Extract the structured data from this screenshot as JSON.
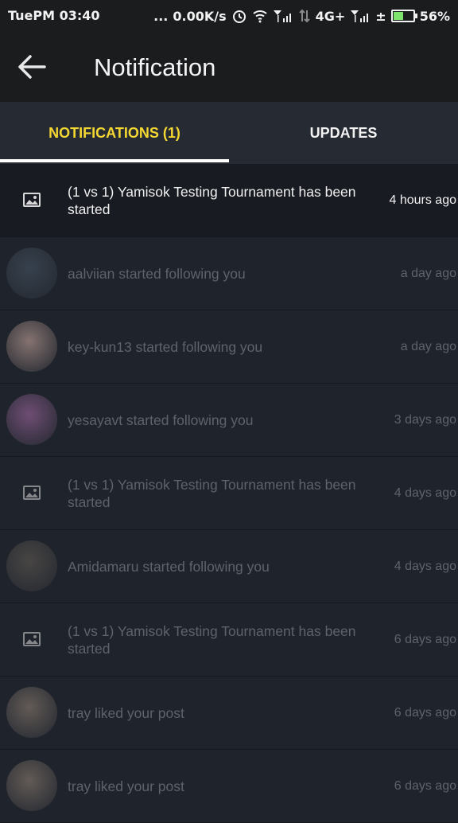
{
  "status_bar": {
    "time": "TuePM 03:40",
    "dots": "...",
    "speed": "0.00K/s",
    "network1": "4G+",
    "plusminus": "±",
    "battery_percent": "56%",
    "battery_level": 0.56,
    "icons": [
      "alarm-icon",
      "wifi-icon",
      "signal-icon",
      "data-arrows-icon",
      "signal-icon",
      "battery-icon"
    ]
  },
  "app_bar": {
    "back_icon": "arrow-left-icon",
    "title": "Notification"
  },
  "tabs": [
    {
      "label": "NOTIFICATIONS (1)",
      "active": true
    },
    {
      "label": "UPDATES",
      "active": false
    }
  ],
  "notifications": [
    {
      "type": "image",
      "icon": "image-placeholder-icon",
      "message": "(1 vs 1) Yamisok Testing Tournament has been started",
      "time": "4 hours ago",
      "unread": true
    },
    {
      "type": "avatar",
      "avatar_color": "#4a5a6a",
      "message": "aalviian started following you",
      "time": "a day ago",
      "unread": false
    },
    {
      "type": "avatar",
      "avatar_color": "#d8b4a8",
      "message": "key-kun13 started following you",
      "time": "a day ago",
      "unread": false
    },
    {
      "type": "avatar",
      "avatar_color": "#b070b0",
      "message": "yesayavt started following you",
      "time": "3 days ago",
      "unread": false
    },
    {
      "type": "image",
      "icon": "image-placeholder-icon",
      "message": "(1 vs 1) Yamisok Testing Tournament has been started",
      "time": "4 days ago",
      "unread": false
    },
    {
      "type": "avatar",
      "avatar_color": "#6a6258",
      "message": "Amidamaru started following you",
      "time": "4 days ago",
      "unread": false
    },
    {
      "type": "image",
      "icon": "image-placeholder-icon",
      "message": "(1 vs 1) Yamisok Testing Tournament has been started",
      "time": "6 days ago",
      "unread": false
    },
    {
      "type": "avatar",
      "avatar_color": "#9a8878",
      "message": "tray liked your post",
      "time": "6 days ago",
      "unread": false
    },
    {
      "type": "avatar",
      "avatar_color": "#9a8878",
      "message": "tray liked your post",
      "time": "6 days ago",
      "unread": false
    }
  ],
  "colors": {
    "background": "#1f232b",
    "tab_bar": "#262b33",
    "active_tab": "#f5d733",
    "read_text": "#5d636d",
    "unread_row": "#181b21"
  }
}
